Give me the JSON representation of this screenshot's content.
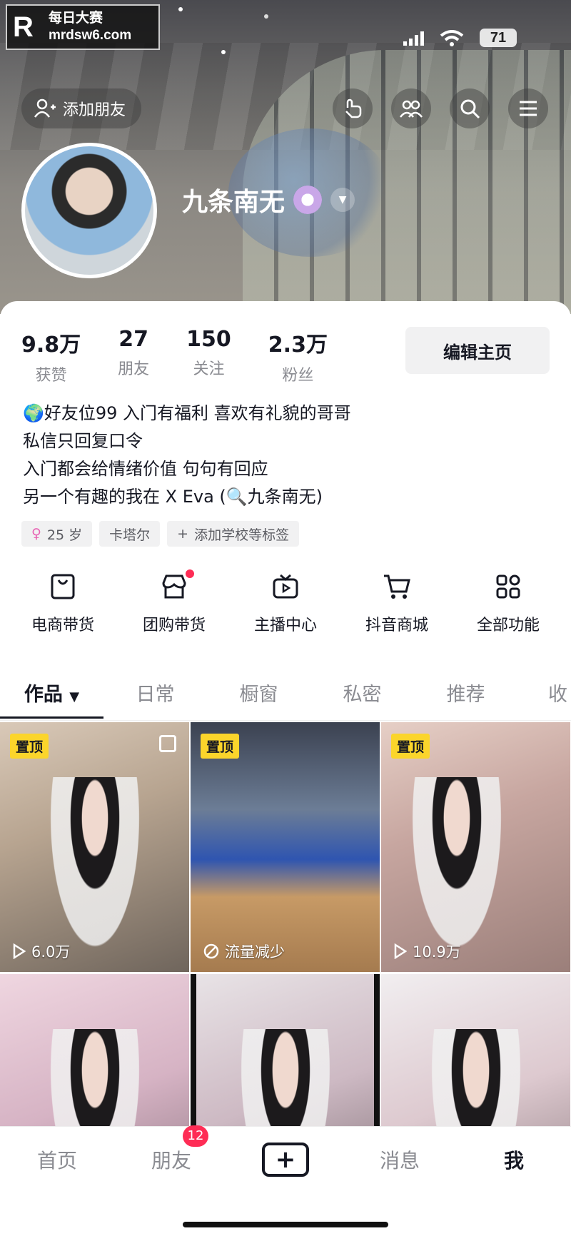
{
  "watermark": {
    "logo": "R",
    "line1": "每日大赛",
    "line2": "mrdsw6.com"
  },
  "status_bar": {
    "battery": "71"
  },
  "header": {
    "add_friend_label": "添加朋友"
  },
  "profile": {
    "nickname": "九条南无",
    "stats": [
      {
        "value": "9.8万",
        "label": "获赞"
      },
      {
        "value": "27",
        "label": "朋友"
      },
      {
        "value": "150",
        "label": "关注"
      },
      {
        "value": "2.3万",
        "label": "粉丝"
      }
    ],
    "edit_label": "编辑主页",
    "bio": [
      "🌍好友位99 入门有福利 喜欢有礼貌的哥哥",
      "私信只回复口令",
      "入门都会给情绪价值 句句有回应",
      "另一个有趣的我在 X Eva (🔍九条南无)"
    ],
    "tags": [
      {
        "icon": "female-icon",
        "text": "25 岁"
      },
      {
        "icon": "",
        "text": "卡塔尔"
      },
      {
        "icon": "plus-icon",
        "text": "添加学校等标签"
      }
    ]
  },
  "features": [
    {
      "icon": "bag-icon",
      "label": "电商带货"
    },
    {
      "icon": "store-icon",
      "label": "团购带货"
    },
    {
      "icon": "tv-icon",
      "label": "主播中心"
    },
    {
      "icon": "cart-icon",
      "label": "抖音商城"
    },
    {
      "icon": "grid-icon",
      "label": "全部功能"
    }
  ],
  "tabs": [
    "作品",
    "日常",
    "橱窗",
    "私密",
    "推荐",
    "收"
  ],
  "videos": [
    {
      "pinned": "置顶",
      "stat": "6.0万",
      "stat_icon": "play-icon"
    },
    {
      "pinned": "置顶",
      "stat": "流量减少",
      "stat_icon": "ban-icon"
    },
    {
      "pinned": "置顶",
      "stat": "10.9万",
      "stat_icon": "play-icon"
    },
    {
      "pinned": "",
      "stat": "",
      "stat_icon": ""
    },
    {
      "pinned": "",
      "stat": "",
      "stat_icon": ""
    },
    {
      "pinned": "",
      "stat": "",
      "stat_icon": ""
    }
  ],
  "bottom_nav": {
    "home": "首页",
    "friends": "朋友",
    "friends_badge": "12",
    "messages": "消息",
    "me": "我"
  }
}
